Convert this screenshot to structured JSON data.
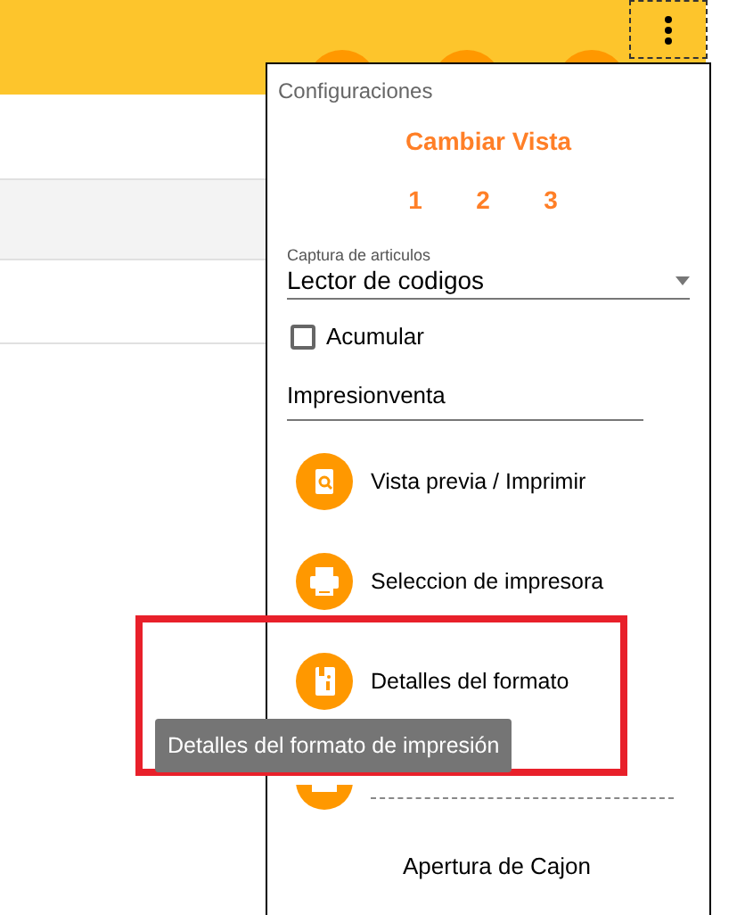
{
  "popup": {
    "title": "Configuraciones",
    "view_heading": "Cambiar Vista",
    "views": [
      "1",
      "2",
      "3"
    ],
    "capture": {
      "label": "Captura de articulos",
      "value": "Lector de codigos"
    },
    "accumulate": {
      "label": "Acumular",
      "checked": false
    },
    "print_format": {
      "value": "Impresionventa"
    },
    "actions": [
      {
        "kind": "preview",
        "label": "Vista previa / Imprimir"
      },
      {
        "kind": "printer",
        "label": "Seleccion de impresora"
      },
      {
        "kind": "info",
        "label": "Detalles del formato"
      },
      {
        "kind": "drawer"
      }
    ],
    "drawer_button": "Apertura de Cajon"
  },
  "tooltip": "Detalles del formato de impresión"
}
